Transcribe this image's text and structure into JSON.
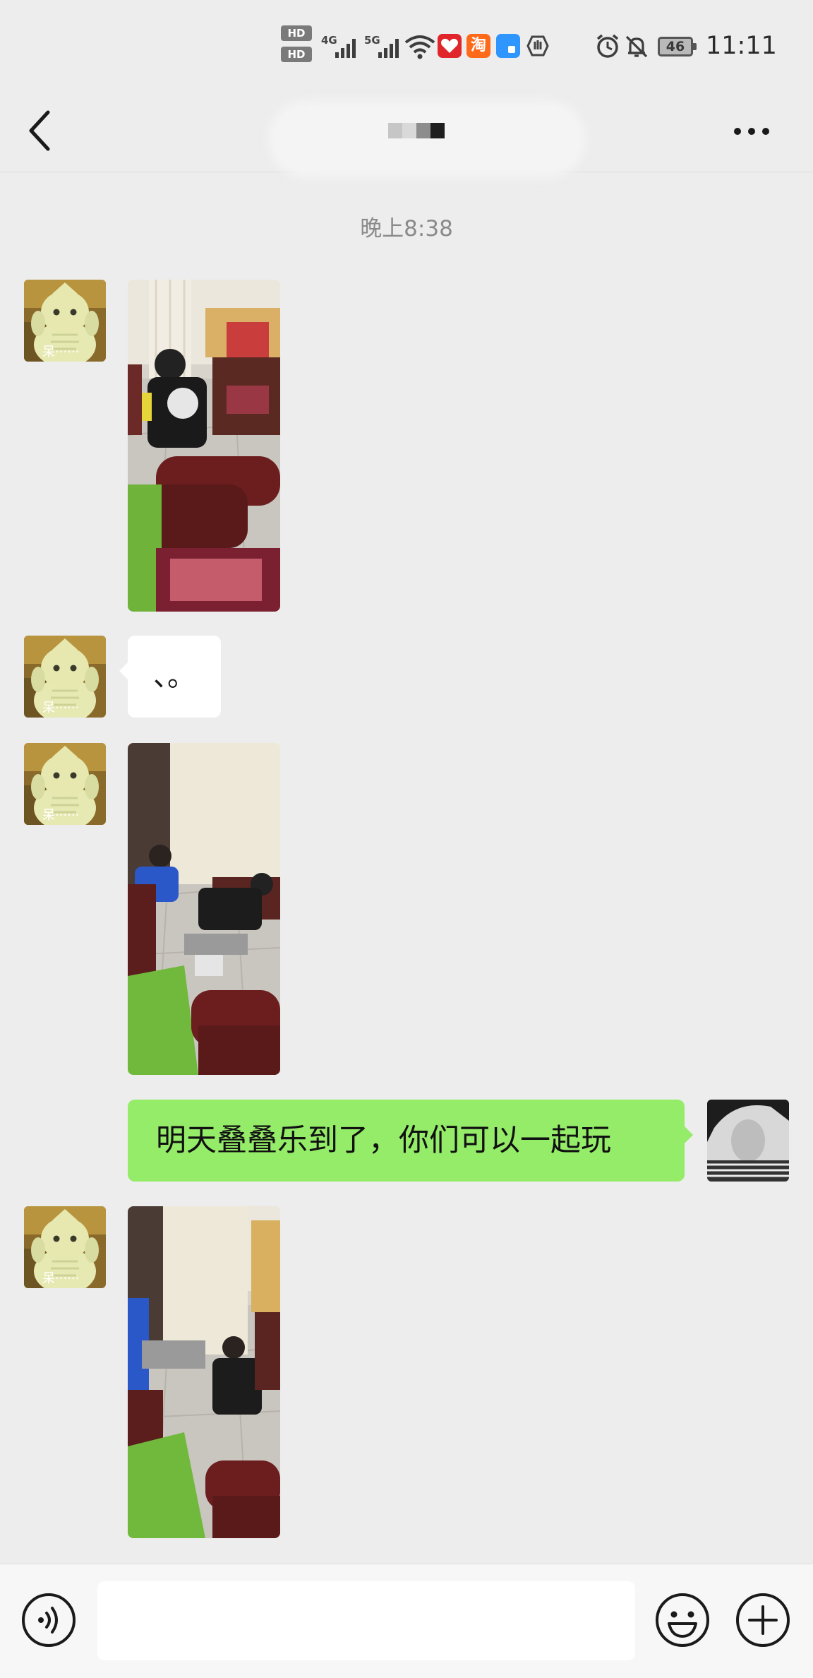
{
  "status_bar": {
    "hd1": "HD",
    "hd2": "HD",
    "network1": "4G",
    "network2": "5G",
    "battery": "46",
    "time": "11:11",
    "taobao_glyph": "淘"
  },
  "header": {
    "back_icon": "chevron-left-icon",
    "more_icon": "more-dots-icon"
  },
  "chat": {
    "timestamp": "晚上8:38",
    "avatar_caption": "呆······",
    "messages": [
      {
        "side": "left",
        "type": "image",
        "content": "photo of children playing on living room floor"
      },
      {
        "side": "left",
        "type": "text",
        "text": "、。"
      },
      {
        "side": "left",
        "type": "image",
        "content": "photo of two boys playing on floor by curtains"
      },
      {
        "side": "right",
        "type": "text",
        "text": "明天叠叠乐到了，你们可以一起玩"
      },
      {
        "side": "left",
        "type": "image",
        "content": "photo of two boys sitting on floor"
      }
    ]
  },
  "input_bar": {
    "voice_icon": "voice-icon",
    "emoji_icon": "emoji-icon",
    "plus_icon": "plus-icon",
    "input_value": ""
  },
  "colors": {
    "background": "#ededed",
    "sent_bubble": "#95ec69",
    "received_bubble": "#ffffff"
  }
}
